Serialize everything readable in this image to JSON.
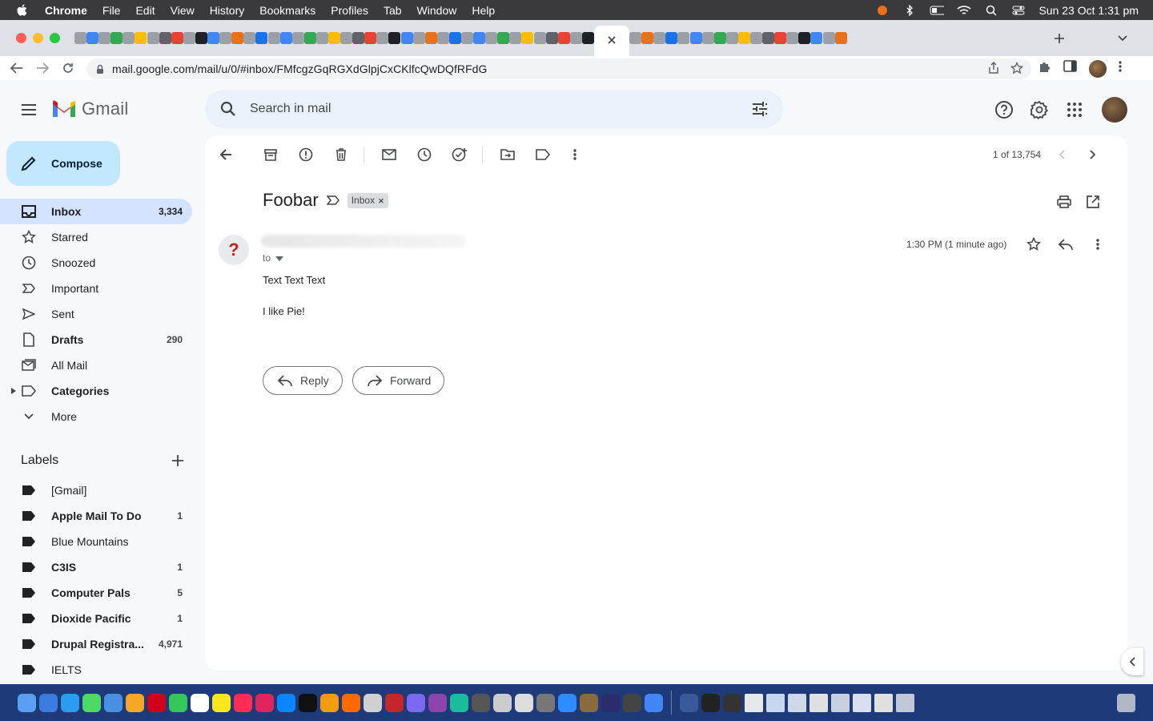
{
  "menubar": {
    "app": "Chrome",
    "items": [
      "File",
      "Edit",
      "View",
      "History",
      "Bookmarks",
      "Profiles",
      "Tab",
      "Window",
      "Help"
    ],
    "clock": "Sun 23 Oct  1:31 pm"
  },
  "browser": {
    "url": "mail.google.com/mail/u/0/#inbox/FMfcgzGqRGXdGlpjCxCKlfcQwDQfRFdG"
  },
  "gmail": {
    "logo_text": "Gmail",
    "search_placeholder": "Search in mail",
    "compose_label": "Compose",
    "nav": [
      {
        "label": "Inbox",
        "count": "3,334",
        "icon": "inbox-icon"
      },
      {
        "label": "Starred",
        "count": "",
        "icon": "star-icon"
      },
      {
        "label": "Snoozed",
        "count": "",
        "icon": "clock-icon"
      },
      {
        "label": "Important",
        "count": "",
        "icon": "important-icon"
      },
      {
        "label": "Sent",
        "count": "",
        "icon": "send-icon"
      },
      {
        "label": "Drafts",
        "count": "290",
        "icon": "draft-icon"
      },
      {
        "label": "All Mail",
        "count": "",
        "icon": "all-mail-icon"
      },
      {
        "label": "Categories",
        "count": "",
        "icon": "label-outline-icon"
      },
      {
        "label": "More",
        "count": "",
        "icon": "chevron-down-icon"
      }
    ],
    "labels_title": "Labels",
    "labels": [
      {
        "name": "[Gmail]",
        "count": ""
      },
      {
        "name": "Apple Mail To Do",
        "count": "1"
      },
      {
        "name": "Blue Mountains",
        "count": ""
      },
      {
        "name": "C3IS",
        "count": "1"
      },
      {
        "name": "Computer Pals",
        "count": "5"
      },
      {
        "name": "Dioxide Pacific",
        "count": "1"
      },
      {
        "name": "Drupal Registra...",
        "count": "4,971"
      },
      {
        "name": "IELTS",
        "count": ""
      }
    ],
    "pager": "1 of 13,754",
    "email": {
      "subject": "Foobar",
      "chip": "Inbox",
      "chip_close": "×",
      "to": "to",
      "time": "1:30 PM (1 minute ago)",
      "avatar_glyph": "?",
      "body": [
        "Text Text Text",
        "I like Pie!"
      ],
      "reply_label": "Reply",
      "forward_label": "Forward"
    }
  },
  "colors": {
    "accent": "#0b57d0",
    "compose_bg": "#c2e7ff",
    "active_nav_bg": "#d3e3fd",
    "search_bg": "#eaf1fb",
    "dock_bg": "#1e3a78"
  }
}
